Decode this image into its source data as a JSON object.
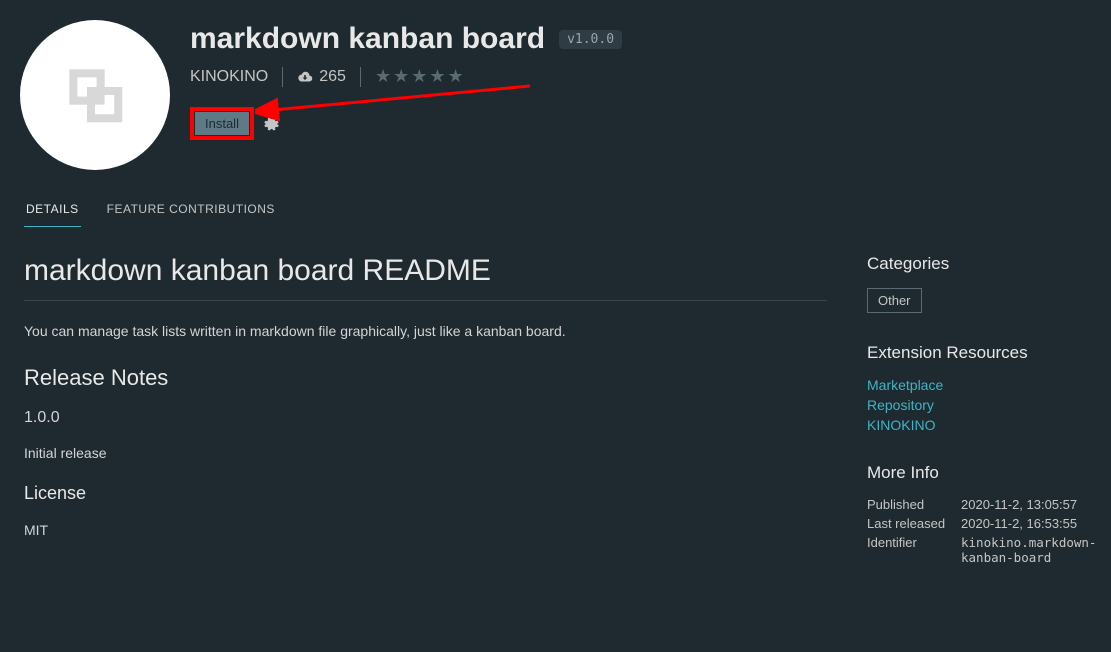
{
  "extension": {
    "title": "markdown kanban board",
    "version": "v1.0.0",
    "publisher": "KINOKINO",
    "downloads": "265",
    "install_label": "Install"
  },
  "tabs": {
    "details": "DETAILS",
    "contributions": "FEATURE CONTRIBUTIONS"
  },
  "readme": {
    "title": "markdown kanban board README",
    "description": "You can manage task lists written in markdown file graphically, just like a kanban board.",
    "release_notes_heading": "Release Notes",
    "version_heading": "1.0.0",
    "version_note": "Initial release",
    "license_heading": "License",
    "license_value": "MIT"
  },
  "sidebar": {
    "categories_heading": "Categories",
    "category": "Other",
    "resources_heading": "Extension Resources",
    "links": {
      "marketplace": "Marketplace",
      "repository": "Repository",
      "publisher": "KINOKINO"
    },
    "moreinfo_heading": "More Info",
    "info": {
      "published_label": "Published",
      "published_value": "2020-11-2, 13:05:57",
      "lastreleased_label": "Last released",
      "lastreleased_value": "2020-11-2, 16:53:55",
      "identifier_label": "Identifier",
      "identifier_value": "kinokino.markdown-kanban-board"
    }
  }
}
